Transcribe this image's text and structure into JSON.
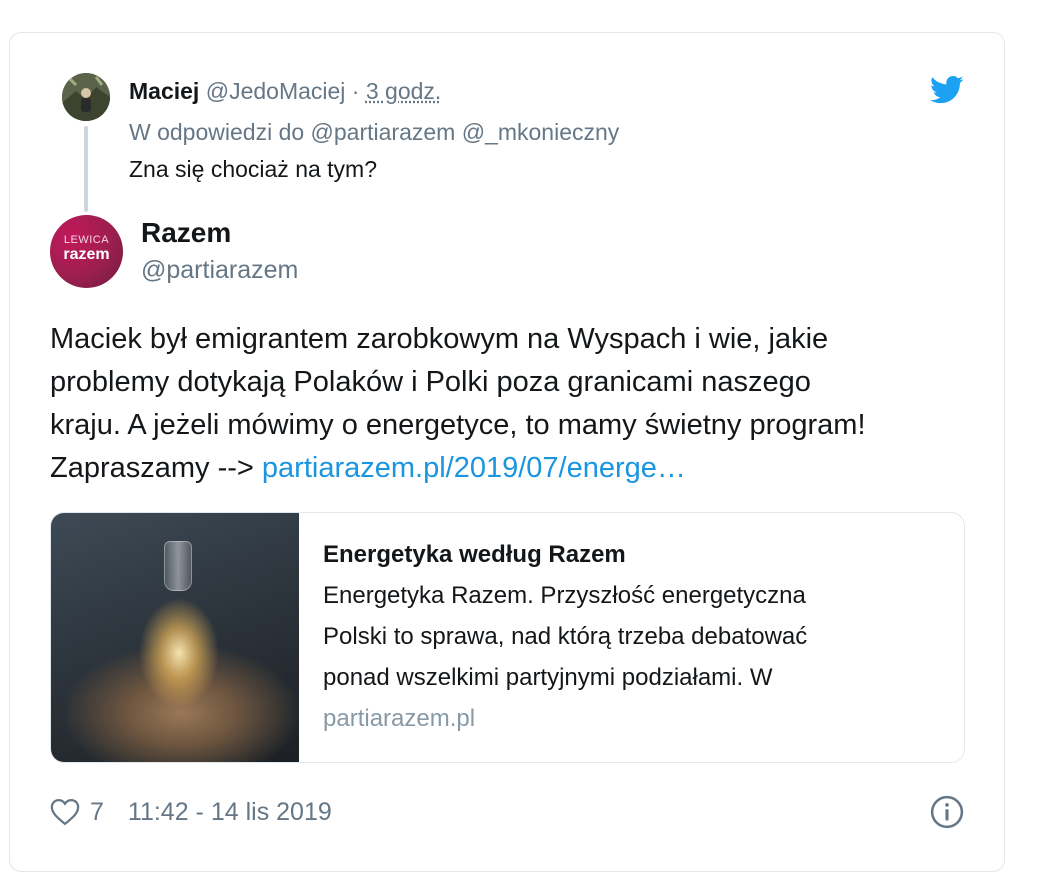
{
  "reply": {
    "name": "Maciej",
    "handle": "@JedoMaciej",
    "separator": "·",
    "time": "3 godz.",
    "reply_to": "W odpowiedzi do @partiarazem @_mkonieczny",
    "text": "Zna się chociaż na tym?"
  },
  "author": {
    "avatar_line1": "LEWICA",
    "avatar_line2": "razem",
    "name": "Razem",
    "handle": "@partiarazem"
  },
  "tweet": {
    "lines": [
      "Maciek był emigrantem zarobkowym na Wyspach i wie, jakie",
      "problemy dotykają Polaków i Polki poza granicami naszego",
      "kraju. A jeżeli mówimy o energetyce, to mamy świetny program!"
    ],
    "last_line_prefix": "Zapraszamy --> ",
    "link_text": "partiarazem.pl/2019/07/energe…"
  },
  "link_card": {
    "title": "Energetyka według Razem",
    "description_lines": [
      "Energetyka Razem. Przyszłość energetyczna",
      "Polski to sprawa, nad którą trzeba debatować",
      "ponad wszelkimi partyjnymi podziałami. W"
    ],
    "domain": "partiarazem.pl"
  },
  "footer": {
    "like_count": "7",
    "timestamp": "11:42 - 14 lis 2019"
  },
  "icons": {
    "brand": "twitter-bird-icon",
    "like": "heart-icon",
    "info": "info-icon"
  },
  "colors": {
    "twitter_blue": "#1da1f2",
    "link": "#1b95e0",
    "secondary_text": "#657786",
    "razem_brand": "#9c1f4e"
  }
}
